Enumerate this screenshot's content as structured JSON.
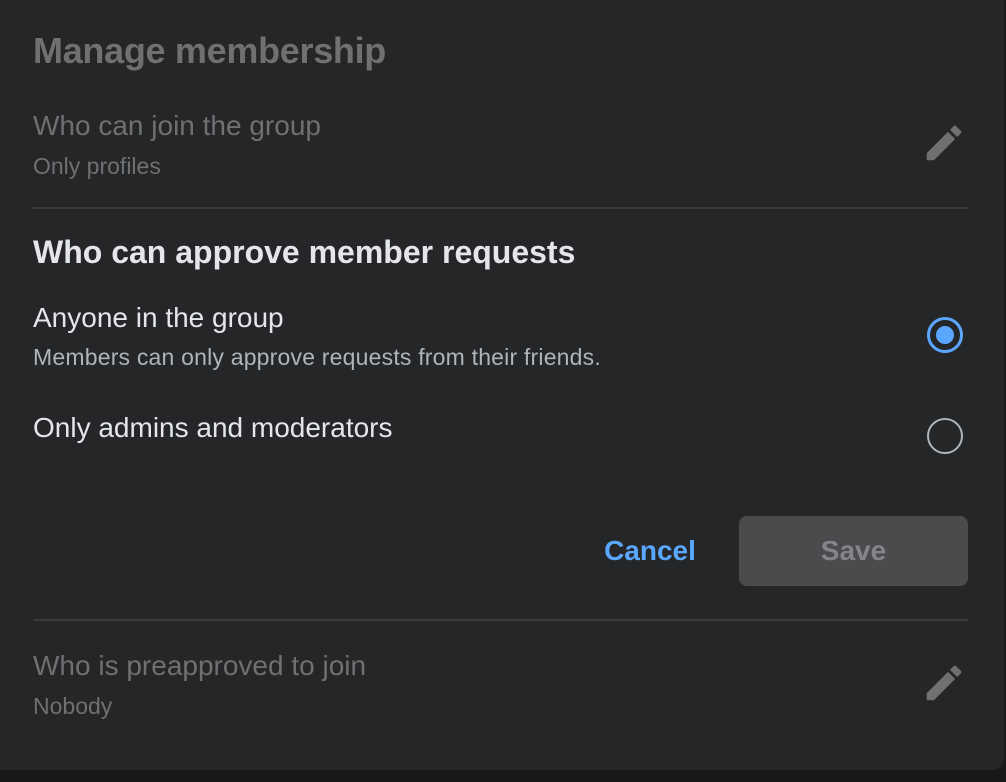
{
  "header": {
    "title": "Manage membership"
  },
  "join_setting": {
    "title": "Who can join the group",
    "value": "Only profiles",
    "edit_icon": "pencil-icon"
  },
  "approve_section": {
    "heading": "Who can approve member requests",
    "options": [
      {
        "label": "Anyone in the group",
        "description": "Members can only approve requests from their friends.",
        "selected": true
      },
      {
        "label": "Only admins and moderators",
        "selected": false
      }
    ]
  },
  "actions": {
    "cancel_label": "Cancel",
    "save_label": "Save"
  },
  "preapproved_setting": {
    "title": "Who is preapproved to join",
    "value": "Nobody",
    "edit_icon": "pencil-icon"
  },
  "colors": {
    "accent": "#5aa7ff",
    "background": "#252628",
    "text_primary": "#e4e6eb",
    "text_muted": "#6e7072",
    "divider": "#3a3b3d"
  }
}
